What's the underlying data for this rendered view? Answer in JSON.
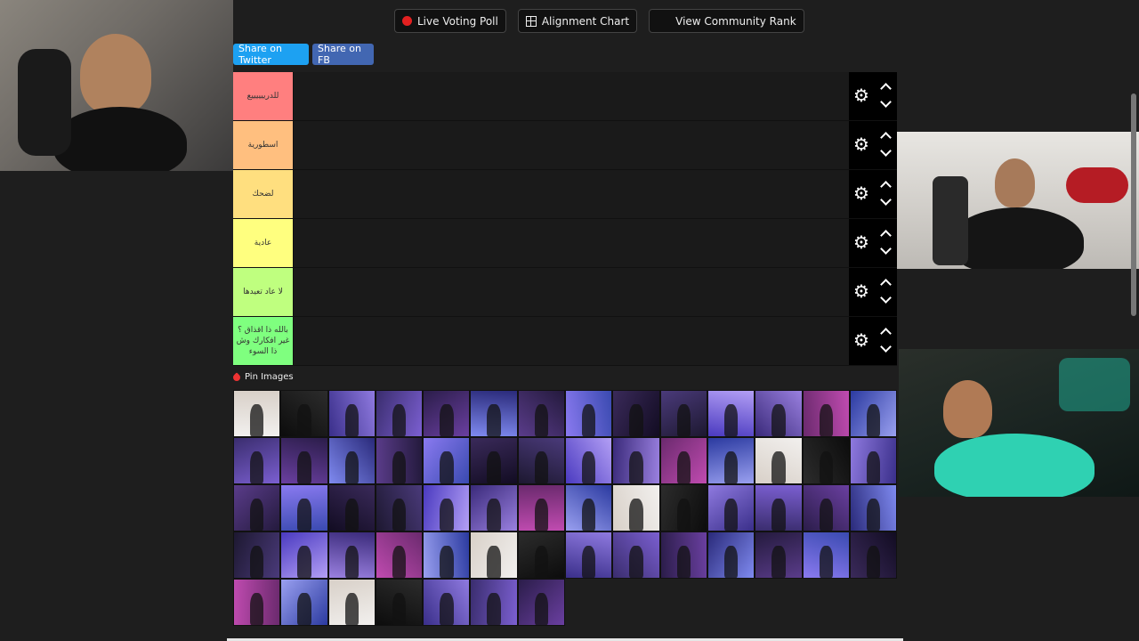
{
  "toolbar": {
    "live_poll": "Live Voting Poll",
    "alignment": "Alignment Chart",
    "community": "View Community Rank"
  },
  "share": {
    "twitter": "Share on Twitter",
    "facebook": "Share on FB"
  },
  "tiers": [
    {
      "label": "للدرييييييع",
      "color": "#ff7f7f"
    },
    {
      "label": "اسطورية",
      "color": "#ffbf7f"
    },
    {
      "label": "لضحك",
      "color": "#ffdf7f"
    },
    {
      "label": "عادية",
      "color": "#ffff7f"
    },
    {
      "label": "لا عاد تعيدها",
      "color": "#bfff7f"
    },
    {
      "label": "بالله ذا اقذاق ؟ غير افكارك وش ذا السوء",
      "color": "#7fff7f"
    }
  ],
  "pool": {
    "title": "Pin Images"
  },
  "colors": {
    "twitter": "#1da1f2",
    "facebook": "#4267b2",
    "poll_dot": "#e32020"
  }
}
